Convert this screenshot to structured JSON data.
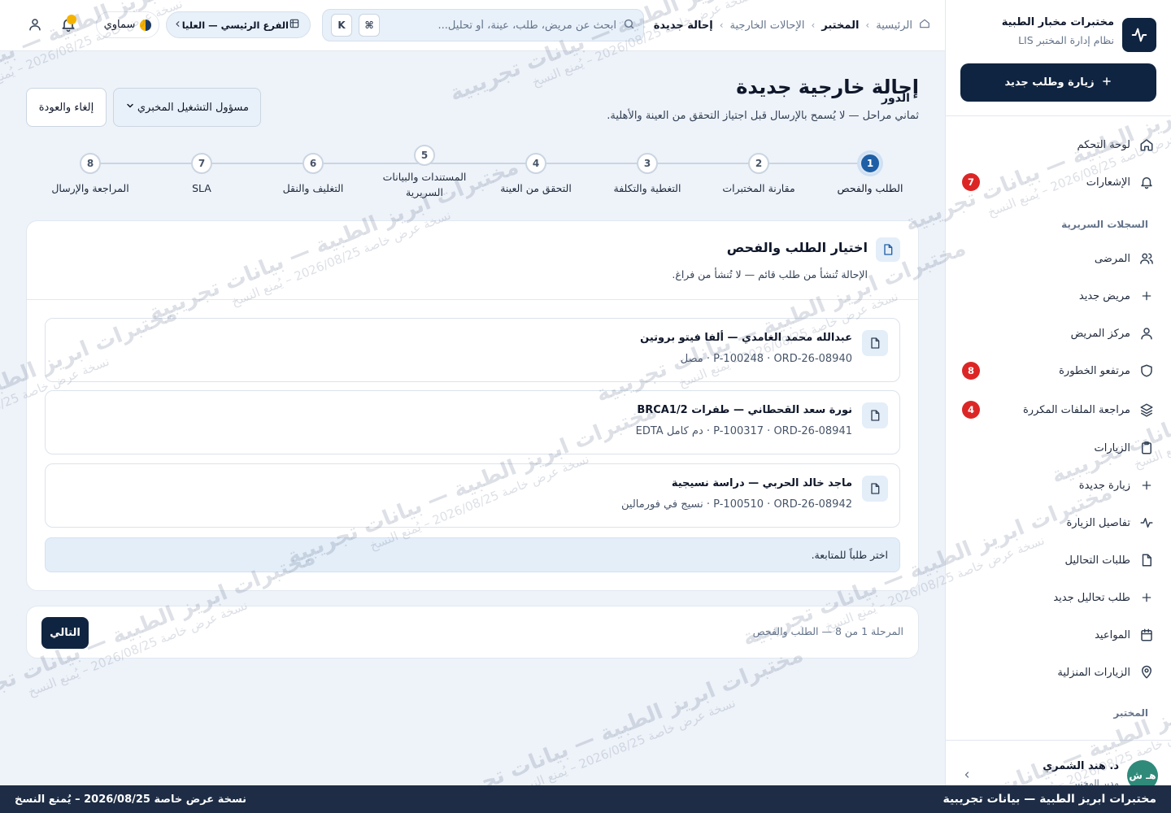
{
  "sidebar": {
    "brand_name": "مختبرات مخبار الطبية",
    "brand_sub": "نظام إدارة المختبر LIS",
    "new_visit_label": "زيارة وطلب جديد",
    "items": [
      {
        "label": "لوحة التحكم",
        "icon": "home-icon"
      },
      {
        "label": "الإشعارات",
        "icon": "bell-icon",
        "badge": "7"
      },
      {
        "label": "المرضى",
        "icon": "users-icon"
      },
      {
        "label": "مريض جديد",
        "icon": "plus-icon"
      },
      {
        "label": "مركز المريض",
        "icon": "user-icon"
      },
      {
        "label": "مرتفعو الخطورة",
        "icon": "shield-icon",
        "badge": "8"
      },
      {
        "label": "مراجعة الملفات المكررة",
        "icon": "layers-icon",
        "badge": "4"
      },
      {
        "label": "الزيارات",
        "icon": "clipboard-icon"
      },
      {
        "label": "زيارة جديدة",
        "icon": "plus-icon"
      },
      {
        "label": "تفاصيل الزيارة",
        "icon": "activity-icon"
      },
      {
        "label": "طلبات التحاليل",
        "icon": "file-icon"
      },
      {
        "label": "طلب تحاليل جديد",
        "icon": "plus-icon"
      },
      {
        "label": "المواعيد",
        "icon": "calendar-icon"
      },
      {
        "label": "الزيارات المنزلية",
        "icon": "map-pin-icon"
      }
    ],
    "section_clinical": "السجلات السريرية",
    "section_lab": "المختبر",
    "user_initials": "هـ ش",
    "user_name": "د. هند الشمري",
    "user_role": "مدير المختبر"
  },
  "topbar": {
    "breadcrumbs": [
      "الرئيسية",
      "المختبر",
      "الإحالات الخارجية",
      "إحالة جديدة"
    ],
    "search_placeholder": "ابحث عن مريض، طلب، عينة، أو تحليل...",
    "kbd_cmd": "⌘",
    "kbd_k": "K",
    "branch_label": "الفرع الرئيسي — العليا",
    "theme_label": "سماوي"
  },
  "page": {
    "title": "إحالة خارجية جديدة",
    "subtitle": "ثماني مراحل — لا يُسمح بالإرسال قبل اجتياز التحقق من العينة والأهلية.",
    "role_label": "الدور",
    "role_value": "مسؤول التشغيل المخبري",
    "cancel_label": "إلغاء والعودة"
  },
  "steps": [
    {
      "num": "1",
      "label": "الطلب والفحص",
      "active": true
    },
    {
      "num": "2",
      "label": "مقارنة المختبرات"
    },
    {
      "num": "3",
      "label": "التغطية والتكلفة"
    },
    {
      "num": "4",
      "label": "التحقق من العينة"
    },
    {
      "num": "5",
      "label": "المستندات والبيانات السريرية"
    },
    {
      "num": "6",
      "label": "التغليف والنقل"
    },
    {
      "num": "7",
      "label": "SLA"
    },
    {
      "num": "8",
      "label": "المراجعة والإرسال"
    }
  ],
  "card": {
    "title": "اختيار الطلب والفحص",
    "subtitle": "الإحالة تُنشأ من طلب قائم — لا تُنشأ من فراغ.",
    "orders": [
      {
        "title": "عبدالله محمد الغامدي — ألفا فيتو بروتين",
        "meta": "P-100248 · ORD-26-08940 · مصل"
      },
      {
        "title": "نورة سعد القحطاني — طفرات BRCA1/2",
        "meta": "P-100317 · ORD-26-08941 · دم كامل EDTA"
      },
      {
        "title": "ماجد خالد الحربي — دراسة نسيجية",
        "meta": "P-100510 · ORD-26-08942 · نسيج في فورمالين"
      }
    ],
    "hint": "اختر طلباً للمتابعة."
  },
  "footer": {
    "status": "المرحلة 1 من 8 — الطلب والفحص",
    "next_label": "التالي"
  },
  "bottom_bar": {
    "brand": "مختبرات ابريز الطبية — بيانات تجريبية",
    "notice": "نسخة عرض خاصة 2026/08/25 – يُمنع النسخ"
  },
  "watermark": {
    "line1": "مختبرات ابريز الطبية — بيانات تجريبية",
    "line2": "نسخة عرض خاصة 2026/08/25 – يُمنع النسخ"
  },
  "colors": {
    "primary": "#0f2440",
    "accent": "#1e5fa6",
    "badge": "#dc2626",
    "theme_yellow": "#f5b301"
  }
}
